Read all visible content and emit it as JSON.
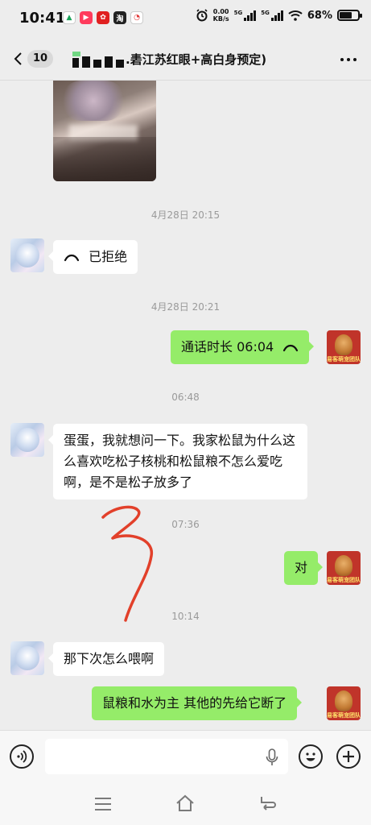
{
  "status_bar": {
    "time": "10:41",
    "net_speed_value": "0.00",
    "net_speed_unit": "KB/s",
    "signal1_label": "5G",
    "signal2_label": "5G",
    "battery": "68%",
    "battery_level": 0.68,
    "apps": [
      "xiaohongshu-icon",
      "video-app-icon",
      "shopping-app-icon",
      "taobao-icon",
      "alarm-app-icon"
    ]
  },
  "header": {
    "unread_count": "10",
    "title": ".砉江苏红眼+高白身预定)"
  },
  "messages": {
    "ts1": "4月28日 20:15",
    "rejected_call": "已拒绝",
    "ts2": "4月28日 20:21",
    "call_duration": "通话时长 06:04",
    "ts3": "06:48",
    "question": "蛋蛋，我就想问一下。我家松鼠为什么这么喜欢吃松子核桃和松鼠粮不怎么爱吃啊，是不是松子放多了",
    "ts4": "07:36",
    "reply_yes": "对",
    "ts5": "10:14",
    "question2": "那下次怎么喂啊",
    "answer": "鼠粮和水为主 其他的先给它断了"
  },
  "avatar_right_text": "易客萌宠团队",
  "input": {
    "value": ""
  },
  "colors": {
    "sent_bubble": "#95ec69",
    "received_bubble": "#ffffff",
    "background": "#ededed"
  }
}
